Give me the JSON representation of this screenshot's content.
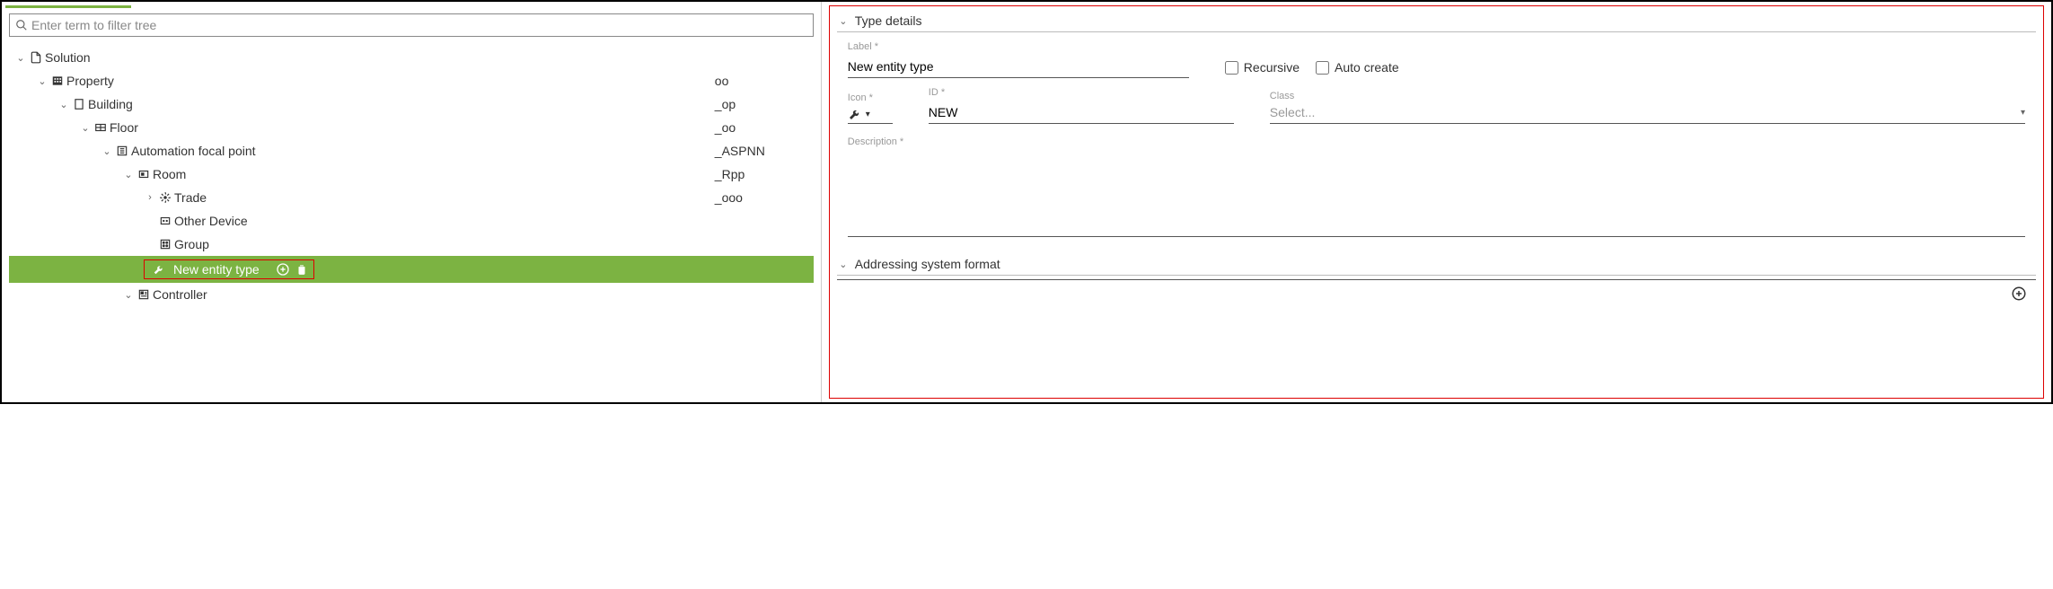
{
  "filter": {
    "placeholder": "Enter term to filter tree"
  },
  "tree": {
    "solution": "Solution",
    "property": {
      "label": "Property",
      "code": "oo"
    },
    "building": {
      "label": "Building",
      "code": "_op"
    },
    "floor": {
      "label": "Floor",
      "code": "_oo"
    },
    "afp": {
      "label": "Automation focal point",
      "code": "_ASPNN"
    },
    "room": {
      "label": "Room",
      "code": "_Rpp"
    },
    "trade": {
      "label": "Trade",
      "code": "_ooo"
    },
    "other": {
      "label": "Other Device"
    },
    "group": {
      "label": "Group"
    },
    "newentity": {
      "label": "New entity type"
    },
    "controller": {
      "label": "Controller"
    }
  },
  "details": {
    "section_title": "Type details",
    "label_label": "Label *",
    "label_value": "New entity type",
    "recursive": "Recursive",
    "autocreate": "Auto create",
    "icon_label": "Icon *",
    "id_label": "ID *",
    "id_value": "NEW",
    "class_label": "Class",
    "class_placeholder": "Select...",
    "desc_label": "Description *",
    "addr_title": "Addressing system format"
  }
}
